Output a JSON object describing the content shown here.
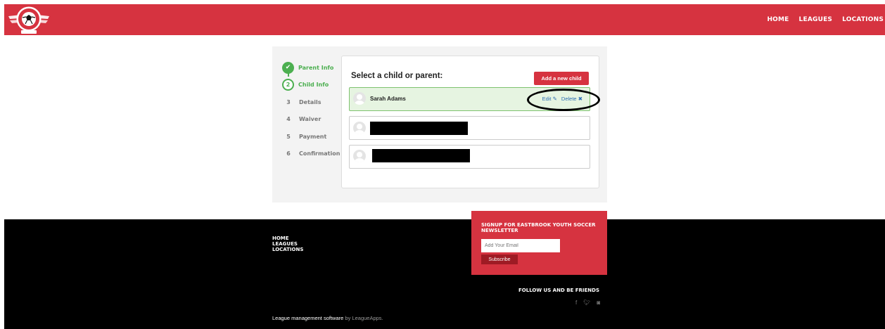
{
  "colors": {
    "brand": "#d63340",
    "success": "#4caf50",
    "link": "#2f6fb3"
  },
  "nav": {
    "links": [
      "HOME",
      "LEAGUES",
      "LOCATIONS"
    ],
    "logo_icon": "soccer-ball-logo"
  },
  "steps": [
    {
      "num": "",
      "label": "Parent Info",
      "state": "done"
    },
    {
      "num": "2",
      "label": "Child Info",
      "state": "active"
    },
    {
      "num": "3",
      "label": "Details",
      "state": "pending"
    },
    {
      "num": "4",
      "label": "Waiver",
      "state": "pending"
    },
    {
      "num": "5",
      "label": "Payment",
      "state": "pending"
    },
    {
      "num": "6",
      "label": "Confirmation",
      "state": "pending"
    }
  ],
  "panel": {
    "title": "Select a child or parent:",
    "add_button": "Add a new child",
    "children": [
      {
        "name": "Sarah Adams",
        "edit": "Edit",
        "delete": "Delete"
      }
    ]
  },
  "footer": {
    "links": [
      "HOME",
      "LEAGUES",
      "LOCATIONS"
    ],
    "newsletter_title": "SIGNUP FOR EASTBROOK YOUTH SOCCER NEWSLETTER",
    "email_placeholder": "Add Your Email",
    "subscribe": "Subscribe",
    "follow": "FOLLOW US AND BE FRIENDS",
    "social_icons": [
      "facebook-icon",
      "twitter-icon",
      "instagram-icon"
    ],
    "copyright_main": "League management software",
    "copyright_by": "by LeagueApps."
  }
}
